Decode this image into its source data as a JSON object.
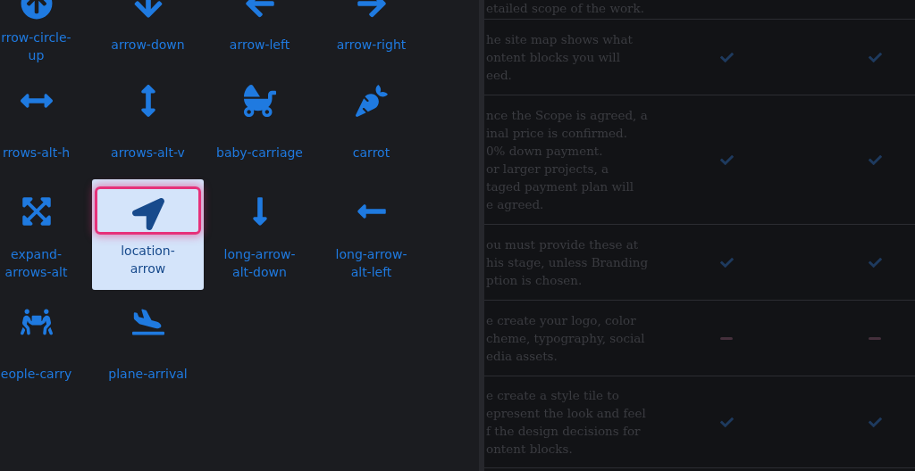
{
  "icon_grid": [
    {
      "label": "rrow-circle-\nup",
      "selected": false
    },
    {
      "label": "arrow-down",
      "selected": false
    },
    {
      "label": "arrow-left",
      "selected": false
    },
    {
      "label": "arrow-right",
      "selected": false
    },
    {
      "label": "rrows-alt-h",
      "selected": false
    },
    {
      "label": "arrows-alt-v",
      "selected": false
    },
    {
      "label": "baby-carriage",
      "selected": false
    },
    {
      "label": "carrot",
      "selected": false
    },
    {
      "label": "expand-\narrows-alt",
      "selected": false
    },
    {
      "label": "location-\narrow",
      "selected": true
    },
    {
      "label": "long-arrow-\nalt-down",
      "selected": false
    },
    {
      "label": "long-arrow-\nalt-left",
      "selected": false
    },
    {
      "label": "eople-carry",
      "selected": false
    },
    {
      "label": "plane-arrival",
      "selected": false
    }
  ],
  "comparison_table": {
    "rows": [
      {
        "description": "etailed scope of the work.",
        "marks": []
      },
      {
        "description": "he site map shows what\nontent blocks you will\need.",
        "marks": [
          {
            "kind": "check"
          },
          {
            "kind": "check"
          }
        ]
      },
      {
        "description": "nce the Scope is agreed, a\ninal price is confirmed.\n0% down payment.\nor larger projects, a\ntaged payment plan will\ne agreed.",
        "marks": [
          {
            "kind": "check"
          },
          {
            "kind": "check"
          }
        ]
      },
      {
        "description": "ou must provide these at\nhis stage, unless Branding\nption is chosen.",
        "marks": [
          {
            "kind": "check"
          },
          {
            "kind": "check"
          }
        ]
      },
      {
        "description": "e create your logo, color\ncheme, typography, social\nedia assets.",
        "marks": [
          {
            "kind": "dash"
          },
          {
            "kind": "dash"
          }
        ]
      },
      {
        "description": "e create a style tile to\nepresent the look and feel\nf the design decisions for\nontent blocks.",
        "marks": [
          {
            "kind": "check"
          },
          {
            "kind": "check"
          }
        ]
      }
    ]
  }
}
